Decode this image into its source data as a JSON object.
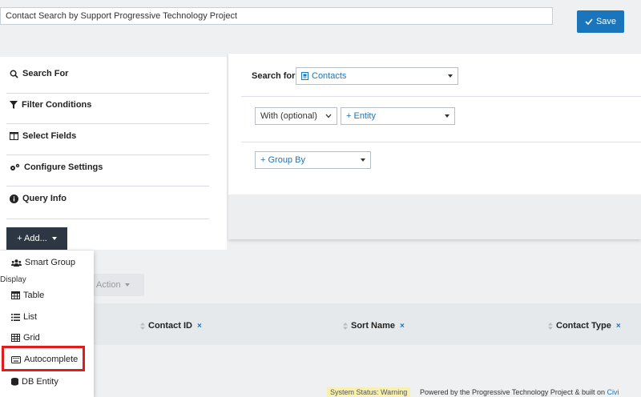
{
  "header": {
    "title_value": "Contact Search by Support Progressive Technology Project",
    "save_label": "Save"
  },
  "left_nav": {
    "items": [
      {
        "label": "Search For",
        "icon": "search-icon"
      },
      {
        "label": "Filter Conditions",
        "icon": "filter-icon"
      },
      {
        "label": "Select Fields",
        "icon": "columns-icon"
      },
      {
        "label": "Configure Settings",
        "icon": "gears-icon"
      },
      {
        "label": "Query Info",
        "icon": "info-icon"
      }
    ],
    "add_label": "+ Add..."
  },
  "search_panel": {
    "search_for_label": "Search for",
    "entity_select": "Contacts",
    "with_select": "With (optional)",
    "entity_add": "+ Entity",
    "group_by": "+ Group By"
  },
  "results": {
    "action_label": "Action",
    "columns": [
      {
        "label": "Contact ID",
        "remove": "×"
      },
      {
        "label": "Sort Name",
        "remove": "×"
      },
      {
        "label": "Contact Type",
        "remove": "×"
      }
    ]
  },
  "add_menu": {
    "smart_group": "Smart Group",
    "display_header": "Display",
    "items": [
      "Table",
      "List",
      "Grid",
      "Autocomplete",
      "DB Entity"
    ]
  },
  "footer": {
    "status": "System Status: Warning",
    "powered": "Powered by the Progressive Technology Project & built on",
    "civi": "Civi"
  },
  "colors": {
    "accent": "#1b75bb",
    "dark_button": "#2c3743",
    "highlight_box": "#e21b1b"
  }
}
